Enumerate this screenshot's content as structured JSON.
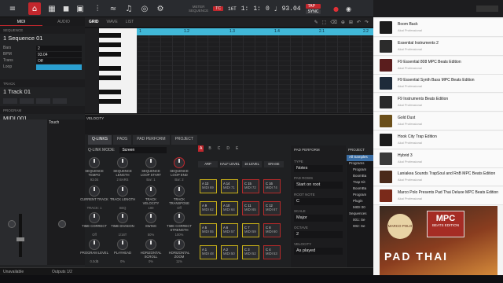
{
  "transport": {
    "meter_label": "METER",
    "meter_value": "TC",
    "sixteenth": "16T",
    "sequence_label": "SEQUENCE",
    "position": [
      "1:",
      "1:",
      "0"
    ],
    "bpm": "93.04",
    "tap": "TAP",
    "sync": "SYNC"
  },
  "left_panel": {
    "tabs": [
      "MIDI",
      "AUDIO"
    ],
    "sequence_head": "SEQUENCE",
    "sequence_name": "1 Sequence 01",
    "fields": [
      {
        "k": "Bars",
        "v": "2"
      },
      {
        "k": "BPM",
        "v": "93.04"
      },
      {
        "k": "Trans",
        "v": "Off"
      },
      {
        "k": "Loop",
        "v": ""
      }
    ],
    "track_head": "TRACK",
    "track_name": "1 Track 01",
    "program_head": "PROGRAM",
    "program_name": "MIDI 001",
    "tooltip": "Touch"
  },
  "editor": {
    "tabs": [
      "GRID",
      "WAVE",
      "LIST"
    ],
    "ruler": [
      "1",
      "1.2",
      "1.3",
      "1.4",
      "2.1",
      "2.2"
    ],
    "velocity_label": "VELOCITY"
  },
  "qlinks": {
    "tabs": [
      "Q-LINKS",
      "PADS",
      "PAD PERFORM",
      "PROJECT"
    ],
    "mode_label": "Q-LINK MODE:",
    "mode_value": "Screen",
    "knobs": [
      {
        "name": "SEQUENCE TEMPO",
        "val": "93.04"
      },
      {
        "name": "SEQUENCE LENGTH",
        "val": "2 BARS"
      },
      {
        "name": "SEQUENCE LOOP START",
        "val": "Bar: 1"
      },
      {
        "name": "SEQUENCE LOOP END",
        "val": "Bar: 2"
      },
      {
        "name": "CURRENT TRACK",
        "val": "TRACK: 1"
      },
      {
        "name": "TRACK LENGTH",
        "val": "SEQ"
      },
      {
        "name": "TRACK VELOCITY",
        "val": "100"
      },
      {
        "name": "TRACK TRANSPOSE",
        "val": "Off"
      },
      {
        "name": "TIME CORRECT",
        "val": "Off"
      },
      {
        "name": "TIME DIVISION",
        "val": "1/16T"
      },
      {
        "name": "SWING",
        "val": "50%"
      },
      {
        "name": "TIME CORRECT STRENGTH",
        "val": "100%"
      },
      {
        "name": "PROGRAM LEVEL",
        "val": "0.0dB"
      },
      {
        "name": "PLAYHEAD",
        "val": "0%"
      },
      {
        "name": "HORIZONTAL SCROLL",
        "val": "0%"
      },
      {
        "name": "HORIZONTAL ZOOM",
        "val": "11%"
      }
    ]
  },
  "pads": {
    "banks": [
      "A",
      "B",
      "C",
      "D",
      "E"
    ],
    "buttons": [
      "ARP",
      "HALF LEVEL",
      "16 LEVEL",
      "ERASE"
    ],
    "grid": [
      [
        {
          "n": "A 13",
          "m": "MIDI 69"
        },
        {
          "n": "A 14",
          "m": "MIDI 71"
        },
        {
          "n": "C 15",
          "m": "MIDI 72"
        },
        {
          "n": "C 16",
          "m": "MIDI 74"
        }
      ],
      [
        {
          "n": "A 9",
          "m": "MIDI 62"
        },
        {
          "n": "A 10",
          "m": "MIDI 64"
        },
        {
          "n": "C 11",
          "m": "MIDI 65"
        },
        {
          "n": "C 12",
          "m": "MIDI 67"
        }
      ],
      [
        {
          "n": "A 5",
          "m": "MIDI 55"
        },
        {
          "n": "A 6",
          "m": "MIDI 57"
        },
        {
          "n": "C 7",
          "m": "MIDI 59"
        },
        {
          "n": "C 8",
          "m": "MIDI 60"
        }
      ],
      [
        {
          "n": "A 1",
          "m": "MIDI 48"
        },
        {
          "n": "A 2",
          "m": "MIDI 50"
        },
        {
          "n": "C 3",
          "m": "MIDI 52"
        },
        {
          "n": "C 4",
          "m": "MIDI 53"
        }
      ]
    ]
  },
  "pad_perform": {
    "title": "PAD PERFORM",
    "type_label": "TYPE",
    "type_value": "Notes",
    "pad_rows_label": "PAD ROWS",
    "pad_rows_value": "Start on root",
    "root_note_label": "ROOT NOTE",
    "root_note_value": "C",
    "scale_label": "SCALE",
    "scale_value": "Major",
    "octave_label": "OCTAVE",
    "octave_value": "2",
    "velocity_label": "VELOCITY",
    "velocity_value": "As played"
  },
  "project": {
    "title": "PROJECT",
    "items": [
      "All Samples",
      "Programs",
      "Program",
      "BoomBa",
      "Trap Kit",
      "BoomBa",
      "Program",
      "Plugin",
      "MIDI 00",
      "Sequences",
      "001: Se",
      "002: Se"
    ]
  },
  "browser": {
    "items": [
      {
        "title": "Boom Back",
        "sub": "Akai Professional"
      },
      {
        "title": "Essential Instruments 2",
        "sub": "Akai Professional"
      },
      {
        "title": "F9 Essential 808 MPC Beats Edition",
        "sub": "Akai Professional"
      },
      {
        "title": "F9 Essential Synth Bass MPC Beats Edition",
        "sub": "Akai Professional"
      },
      {
        "title": "F9 Instruments Beats Edition",
        "sub": "Akai Professional"
      },
      {
        "title": "Gold Dust",
        "sub": "Akai Professional"
      },
      {
        "title": "Hook City Trap Edition",
        "sub": "Akai Professional"
      },
      {
        "title": "Hybrid 3",
        "sub": "Akai Professional"
      },
      {
        "title": "Laniakea Sounds TrapSoul and RnB MPC Beats Edition",
        "sub": "Akai Professional"
      },
      {
        "title": "Marco Polo Presents Pad Thai Deluxe MPC Beats Edition",
        "sub": "Akai Professional"
      }
    ],
    "promo_line1": "MPC",
    "promo_line2": "BEATS EDITION",
    "promo_brand": "MARCO POLO",
    "promo_art": "PAD THAI"
  },
  "status": {
    "left": "Unavailable",
    "outputs": "Outputs 1/2"
  },
  "colors": {
    "accent": "#c2272d",
    "ruler": "#41b8d8",
    "pad_yellow": "#c9b018",
    "pad_red": "#b52a2a"
  }
}
